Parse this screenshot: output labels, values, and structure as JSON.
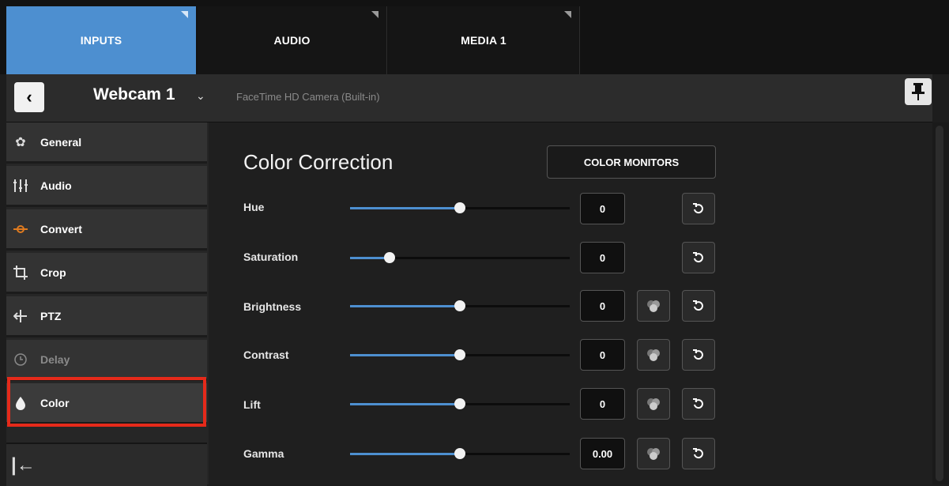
{
  "tabs": [
    {
      "label": "INPUTS",
      "active": true
    },
    {
      "label": "AUDIO",
      "active": false
    },
    {
      "label": "MEDIA 1",
      "active": false
    }
  ],
  "header": {
    "input_name": "Webcam 1",
    "device": "FaceTime HD Camera (Built-in)",
    "back_icon": "chevron-left-icon",
    "dropdown_icon": "chevron-down-icon",
    "pin_icon": "pin-icon"
  },
  "sidebar": {
    "items": [
      {
        "label": "General",
        "icon": "gear-icon"
      },
      {
        "label": "Audio",
        "icon": "mixer-icon"
      },
      {
        "label": "Convert",
        "icon": "convert-icon"
      },
      {
        "label": "Crop",
        "icon": "crop-icon"
      },
      {
        "label": "PTZ",
        "icon": "ptz-icon"
      },
      {
        "label": "Delay",
        "icon": "clock-icon"
      },
      {
        "label": "Color",
        "icon": "droplet-icon"
      }
    ],
    "selected": "Color",
    "collapse_icon": "collapse-left-icon"
  },
  "main": {
    "title": "Color Correction",
    "color_monitors_label": "COLOR MONITORS",
    "rows": [
      {
        "label": "Hue",
        "value": "0",
        "level": 0.5,
        "monitor": false
      },
      {
        "label": "Saturation",
        "value": "0",
        "level": 0.18,
        "monitor": false
      },
      {
        "label": "Brightness",
        "value": "0",
        "level": 0.5,
        "monitor": true
      },
      {
        "label": "Contrast",
        "value": "0",
        "level": 0.5,
        "monitor": true
      },
      {
        "label": "Lift",
        "value": "0",
        "level": 0.5,
        "monitor": true
      },
      {
        "label": "Gamma",
        "value": "0.00",
        "level": 0.5,
        "monitor": true
      }
    ]
  },
  "colors": {
    "accent": "#4d8fd0",
    "highlight": "#e52a1a",
    "convert_icon": "#e07b1f"
  }
}
